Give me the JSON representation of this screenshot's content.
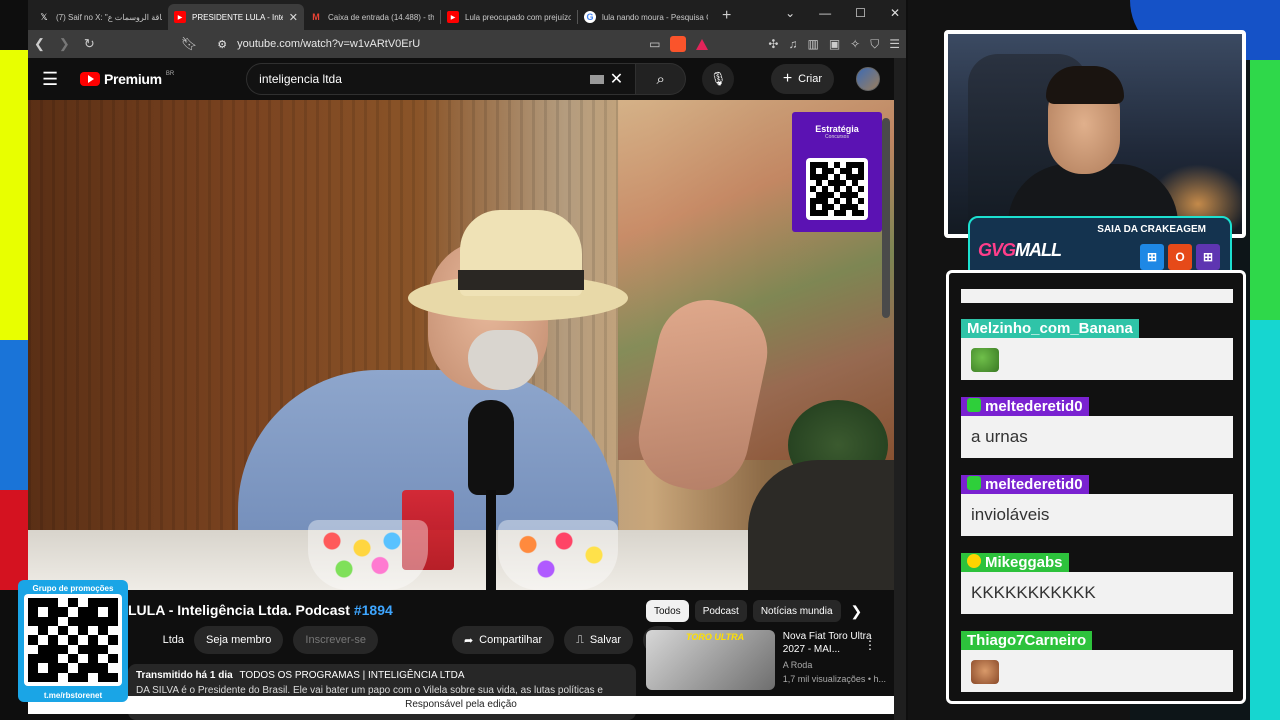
{
  "browser": {
    "tabs": [
      {
        "title": "(7) Saif no X: \"بطاقة الروسمات ع",
        "favicon": "x-icon",
        "active": false
      },
      {
        "title": "PRESIDENTE LULA - Inte",
        "favicon": "youtube-icon",
        "active": true
      },
      {
        "title": "Caixa de entrada (14.488) - theb",
        "favicon": "gmail-icon",
        "active": false
      },
      {
        "title": "Lula preocupado com prejuízo e",
        "favicon": "youtube-icon",
        "active": false
      },
      {
        "title": "lula nando moura - Pesquisa Go",
        "favicon": "google-icon",
        "active": false
      }
    ],
    "url": "youtube.com/watch?v=w1vARtV0ErU"
  },
  "youtube": {
    "brand": "Premium",
    "region": "BR",
    "search_value": "inteligencia ltda",
    "create_label": "Criar",
    "video": {
      "title": "LULA - Inteligência Ltda. Podcast",
      "episode_tag": "#1894",
      "channel": "Ltda",
      "member_label": "Seja membro",
      "subscribe_label": "Inscrever-se",
      "share_label": "Compartilhar",
      "save_label": "Salvar",
      "broadcast_meta": "Transmitido há 1 dia",
      "categories": "TODOS OS PROGRAMAS | INTELIGÊNCIA LTDA",
      "description": "DA SILVA é o Presidente do Brasil. Ele vai bater um papo com o Vilela sobre sua vida, as lutas políticas e"
    },
    "ad": {
      "brand": "Estratégia",
      "subtitle": "Concursos"
    },
    "recommendations": {
      "chips": [
        "Todos",
        "Podcast",
        "Notícias mundia"
      ],
      "first": {
        "title": "Nova Fiat Toro Ultra 2027 - MAI...",
        "channel": "A Roda",
        "views": "1,7 mil visualizações • h...",
        "thumb_label": "TORO ULTRA"
      }
    },
    "caption": "Responsável pela edição"
  },
  "overlay": {
    "promo_title": "Grupo de promoções",
    "promo_url": "t.me/rbstorenet",
    "sponsor_header": "SAIA DA CRAKEAGEM",
    "sponsor_logo_a": "GVG",
    "sponsor_logo_b": "MALL"
  },
  "chat": [
    {
      "user": "Melzinho_com_Banana",
      "color": "#2fc4a8",
      "badge": "",
      "text": "",
      "emote": "frog-emote"
    },
    {
      "user": "meltederetid0",
      "color": "#7a22d1",
      "badge": "#2ecf3a",
      "text": "a urnas"
    },
    {
      "user": "meltederetid0",
      "color": "#7a22d1",
      "badge": "#2ecf3a",
      "text": "invioláveis"
    },
    {
      "user": "Mikeggabs",
      "color": "#2dc23c",
      "badge": "#ffd400",
      "text": "KKKKKKKKKKK"
    },
    {
      "user": "Thiago7Carneiro",
      "color": "#2dc23c",
      "badge": "",
      "text": "",
      "emote": "face-emote"
    }
  ],
  "colors": {
    "accent": "#ff0000",
    "link": "#3ea6ff"
  }
}
